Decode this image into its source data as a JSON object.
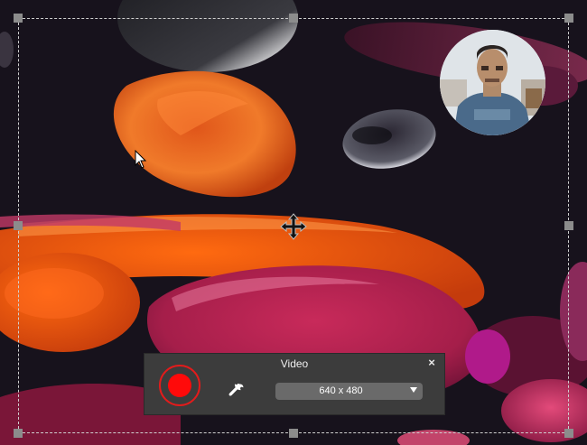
{
  "recorder": {
    "panel_title": "Video",
    "close_label": "×",
    "resolution": "640 x 480",
    "record_color": "#ff0a0a"
  },
  "icons": {
    "record": "record-icon",
    "settings": "wrench-icon",
    "dropdown": "chevron-down-icon",
    "move": "move-icon",
    "cursor": "mouse-pointer-icon",
    "close": "close-icon"
  },
  "colors": {
    "background": "#17121c",
    "panel": "#3c3c3c",
    "select": "#6a6a6a",
    "frame_border": "#cfcfcf",
    "handle": "#8c8c8c"
  }
}
